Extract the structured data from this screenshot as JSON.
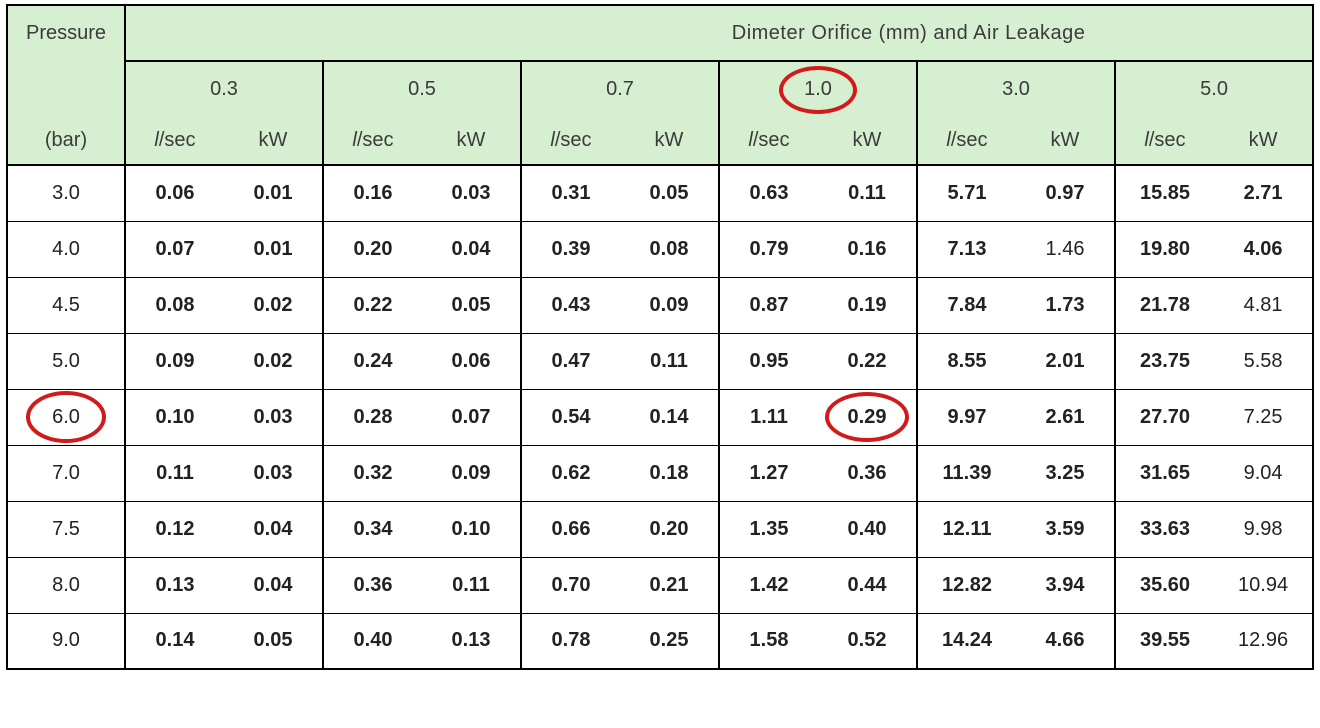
{
  "header": {
    "pressure_label": "Pressure",
    "pressure_unit": "(bar)",
    "banner": "Dimeter Orifice (mm)      and   Air Leakage",
    "unit_flow": "l/sec",
    "unit_power": "kW"
  },
  "diameters": [
    "0.3",
    "0.5",
    "0.7",
    "1.0",
    "3.0",
    "5.0"
  ],
  "rows": [
    {
      "p": "3.0",
      "v": [
        "0.06",
        "0.01",
        "0.16",
        "0.03",
        "0.31",
        "0.05",
        "0.63",
        "0.11",
        "5.71",
        "0.97",
        "15.85",
        "2.71"
      ]
    },
    {
      "p": "4.0",
      "v": [
        "0.07",
        "0.01",
        "0.20",
        "0.04",
        "0.39",
        "0.08",
        "0.79",
        "0.16",
        "7.13",
        "1.46",
        "19.80",
        "4.06"
      ]
    },
    {
      "p": "4.5",
      "v": [
        "0.08",
        "0.02",
        "0.22",
        "0.05",
        "0.43",
        "0.09",
        "0.87",
        "0.19",
        "7.84",
        "1.73",
        "21.78",
        "4.81"
      ]
    },
    {
      "p": "5.0",
      "v": [
        "0.09",
        "0.02",
        "0.24",
        "0.06",
        "0.47",
        "0.11",
        "0.95",
        "0.22",
        "8.55",
        "2.01",
        "23.75",
        "5.58"
      ]
    },
    {
      "p": "6.0",
      "v": [
        "0.10",
        "0.03",
        "0.28",
        "0.07",
        "0.54",
        "0.14",
        "1.11",
        "0.29",
        "9.97",
        "2.61",
        "27.70",
        "7.25"
      ]
    },
    {
      "p": "7.0",
      "v": [
        "0.11",
        "0.03",
        "0.32",
        "0.09",
        "0.62",
        "0.18",
        "1.27",
        "0.36",
        "11.39",
        "3.25",
        "31.65",
        "9.04"
      ]
    },
    {
      "p": "7.5",
      "v": [
        "0.12",
        "0.04",
        "0.34",
        "0.10",
        "0.66",
        "0.20",
        "1.35",
        "0.40",
        "12.11",
        "3.59",
        "33.63",
        "9.98"
      ]
    },
    {
      "p": "8.0",
      "v": [
        "0.13",
        "0.04",
        "0.36",
        "0.11",
        "0.70",
        "0.21",
        "1.42",
        "0.44",
        "12.82",
        "3.94",
        "35.60",
        "10.94"
      ]
    },
    {
      "p": "9.0",
      "v": [
        "0.14",
        "0.05",
        "0.40",
        "0.13",
        "0.78",
        "0.25",
        "1.58",
        "0.52",
        "14.24",
        "4.66",
        "39.55",
        "12.96"
      ]
    }
  ],
  "highlight": {
    "diameter_index": 3,
    "row_index": 4,
    "cell_col": 7
  },
  "nonbold_cells": [
    [
      1,
      9
    ],
    [
      2,
      11
    ],
    [
      3,
      11
    ],
    [
      4,
      11
    ],
    [
      5,
      11
    ],
    [
      6,
      11
    ],
    [
      7,
      11
    ],
    [
      8,
      11
    ]
  ],
  "chart_data": {
    "type": "table",
    "title": "Dimeter Orifice (mm) and Air Leakage",
    "row_label": "Pressure (bar)",
    "column_groups": [
      "0.3",
      "0.5",
      "0.7",
      "1.0",
      "3.0",
      "5.0"
    ],
    "sub_columns": [
      "l/sec",
      "kW"
    ],
    "pressures": [
      3.0,
      4.0,
      4.5,
      5.0,
      6.0,
      7.0,
      7.5,
      8.0,
      9.0
    ],
    "data": {
      "0.3": {
        "l/sec": [
          0.06,
          0.07,
          0.08,
          0.09,
          0.1,
          0.11,
          0.12,
          0.13,
          0.14
        ],
        "kW": [
          0.01,
          0.01,
          0.02,
          0.02,
          0.03,
          0.03,
          0.04,
          0.04,
          0.05
        ]
      },
      "0.5": {
        "l/sec": [
          0.16,
          0.2,
          0.22,
          0.24,
          0.28,
          0.32,
          0.34,
          0.36,
          0.4
        ],
        "kW": [
          0.03,
          0.04,
          0.05,
          0.06,
          0.07,
          0.09,
          0.1,
          0.11,
          0.13
        ]
      },
      "0.7": {
        "l/sec": [
          0.31,
          0.39,
          0.43,
          0.47,
          0.54,
          0.62,
          0.66,
          0.7,
          0.78
        ],
        "kW": [
          0.05,
          0.08,
          0.09,
          0.11,
          0.14,
          0.18,
          0.2,
          0.21,
          0.25
        ]
      },
      "1.0": {
        "l/sec": [
          0.63,
          0.79,
          0.87,
          0.95,
          1.11,
          1.27,
          1.35,
          1.42,
          1.58
        ],
        "kW": [
          0.11,
          0.16,
          0.19,
          0.22,
          0.29,
          0.36,
          0.4,
          0.44,
          0.52
        ]
      },
      "3.0": {
        "l/sec": [
          5.71,
          7.13,
          7.84,
          8.55,
          9.97,
          11.39,
          12.11,
          12.82,
          14.24
        ],
        "kW": [
          0.97,
          1.46,
          1.73,
          2.01,
          2.61,
          3.25,
          3.59,
          3.94,
          4.66
        ]
      },
      "5.0": {
        "l/sec": [
          15.85,
          19.8,
          21.78,
          23.75,
          27.7,
          31.65,
          33.63,
          35.6,
          39.55
        ],
        "kW": [
          2.71,
          4.06,
          4.81,
          5.58,
          7.25,
          9.04,
          9.98,
          10.94,
          12.96
        ]
      }
    },
    "highlighted": {
      "pressure": 6.0,
      "diameter": 1.0,
      "value_kW": 0.29
    }
  }
}
